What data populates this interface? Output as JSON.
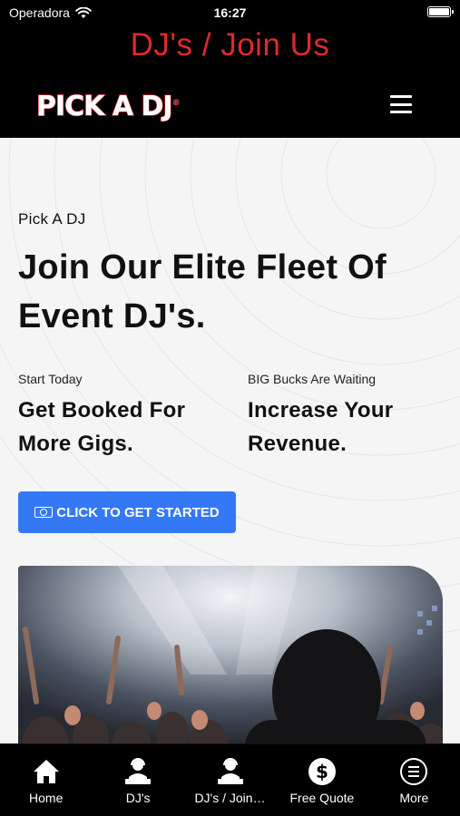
{
  "status_bar": {
    "carrier": "Operadora",
    "time": "16:27",
    "icons": [
      "wifi-icon",
      "battery-icon"
    ]
  },
  "app_title": "DJ's / Join Us",
  "header": {
    "logo_text": "PICK A DJ",
    "logo_mark": "®",
    "menu_icon": "hamburger-menu-icon"
  },
  "main": {
    "eyebrow": "Pick A DJ",
    "headline": "Join Our Elite Fleet Of Event DJ's.",
    "col_left": {
      "small": "Start Today",
      "big": "Get Booked For More Gigs."
    },
    "col_right": {
      "small": "BIG Bucks Are Waiting",
      "big": "Increase Your Revenue."
    },
    "cta_label": "CLICK TO GET STARTED",
    "cta_icon": "money-icon",
    "hero_image": "concert-crowd-photo"
  },
  "tabs": [
    {
      "label": "Home",
      "icon": "home-icon"
    },
    {
      "label": "DJ's",
      "icon": "dj-icon"
    },
    {
      "label": "DJ's / Join…",
      "icon": "dj-join-icon"
    },
    {
      "label": "Free Quote",
      "icon": "dollar-icon"
    },
    {
      "label": "More",
      "icon": "more-icon"
    }
  ],
  "colors": {
    "accent_red": "#e0282e",
    "cta_blue": "#3478f6",
    "background": "#f5f5f6"
  }
}
